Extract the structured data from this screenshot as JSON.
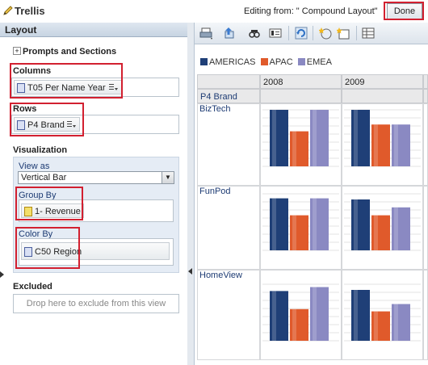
{
  "header": {
    "title": "Trellis",
    "editing_text": "Editing from: \" Compound Layout\"",
    "done_label": "Done"
  },
  "left_panel": {
    "title": "Layout",
    "prompts_sections": "Prompts and Sections",
    "columns_label": "Columns",
    "columns_chip": "T05 Per Name Year",
    "rows_label": "Rows",
    "rows_chip": "P4 Brand",
    "visualization_label": "Visualization",
    "view_as_label": "View as",
    "view_as_value": "Vertical Bar",
    "group_by_label": "Group By",
    "group_by_chip": "1- Revenue",
    "color_by_label": "Color By",
    "color_by_chip": "C50 Region",
    "excluded_label": "Excluded",
    "excluded_hint": "Drop here to exclude from this view"
  },
  "toolbar": {
    "icons": [
      "print-icon",
      "export-icon",
      "preview-icon",
      "properties-icon",
      "refresh-icon",
      "new-calc-icon",
      "settings-icon",
      "table-view-icon"
    ]
  },
  "trellis": {
    "legend": [
      {
        "name": "AMERICAS",
        "color": "#1f3f77"
      },
      {
        "name": "APAC",
        "color": "#e05a2b"
      },
      {
        "name": "EMEA",
        "color": "#8a89c2"
      }
    ],
    "column_headers": [
      "2008",
      "2009"
    ],
    "row_dim_header": "P4 Brand",
    "rows": [
      "BizTech",
      "FunPod",
      "HomeView"
    ]
  },
  "chart_data": {
    "type": "bar",
    "title": "",
    "series_names": [
      "AMERICAS",
      "APAC",
      "EMEA"
    ],
    "panels": [
      {
        "row": "BizTech",
        "col": "2008",
        "values": [
          1.0,
          0.62,
          1.0
        ]
      },
      {
        "row": "BizTech",
        "col": "2009",
        "values": [
          1.0,
          0.74,
          0.74
        ]
      },
      {
        "row": "FunPod",
        "col": "2008",
        "values": [
          0.92,
          0.62,
          0.92
        ]
      },
      {
        "row": "FunPod",
        "col": "2009",
        "values": [
          0.9,
          0.62,
          0.76
        ]
      },
      {
        "row": "HomeView",
        "col": "2008",
        "values": [
          0.88,
          0.56,
          0.95
        ]
      },
      {
        "row": "HomeView",
        "col": "2009",
        "values": [
          0.9,
          0.52,
          0.65
        ]
      }
    ]
  }
}
